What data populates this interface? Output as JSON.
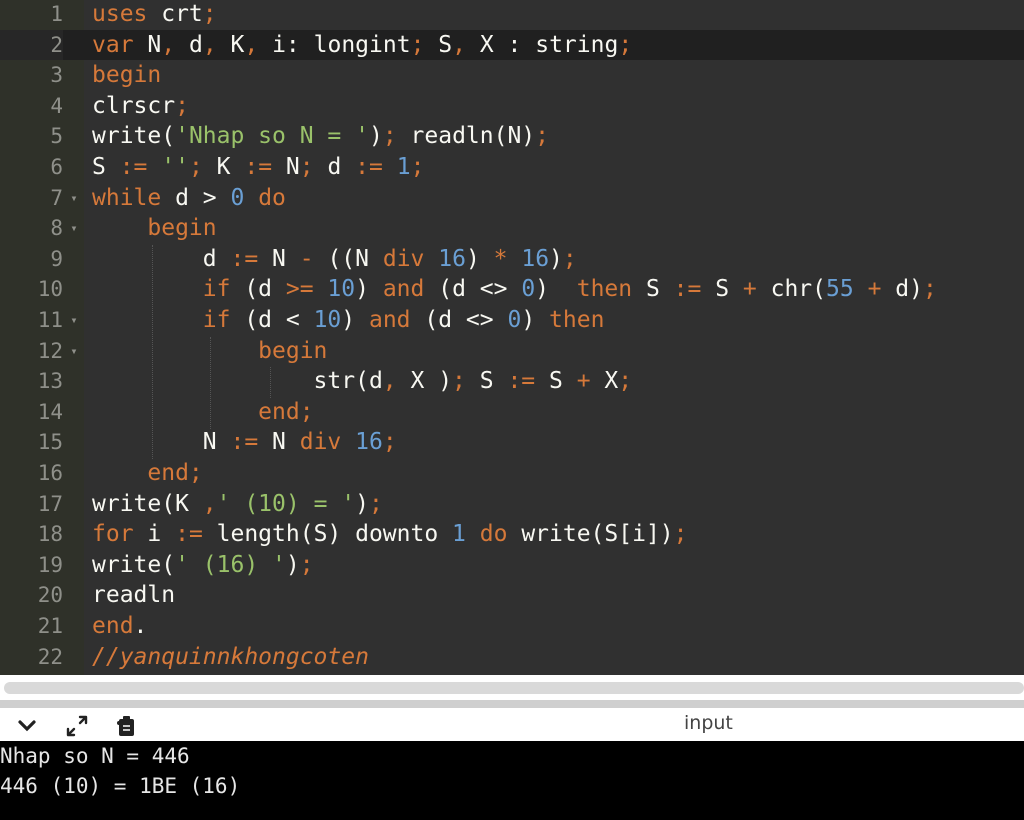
{
  "editor": {
    "lines": [
      {
        "n": "1",
        "tokens": [
          {
            "t": "uses",
            "c": "kw"
          },
          {
            "t": " crt",
            "c": "pl"
          },
          {
            "t": ";",
            "c": "op"
          }
        ]
      },
      {
        "n": "2",
        "active": true,
        "tokens": [
          {
            "t": "var",
            "c": "kw"
          },
          {
            "t": " N",
            "c": "pl"
          },
          {
            "t": ",",
            "c": "op"
          },
          {
            "t": " d",
            "c": "pl"
          },
          {
            "t": ",",
            "c": "op"
          },
          {
            "t": " K",
            "c": "pl"
          },
          {
            "t": ",",
            "c": "op"
          },
          {
            "t": " i: longint",
            "c": "pl"
          },
          {
            "t": ";",
            "c": "op"
          },
          {
            "t": " S",
            "c": "pl"
          },
          {
            "t": ",",
            "c": "op"
          },
          {
            "t": " X : string",
            "c": "pl"
          },
          {
            "t": ";",
            "c": "op"
          }
        ]
      },
      {
        "n": "3",
        "tokens": [
          {
            "t": "begin",
            "c": "kw"
          }
        ]
      },
      {
        "n": "4",
        "tokens": [
          {
            "t": "clrscr",
            "c": "pl"
          },
          {
            "t": ";",
            "c": "op"
          }
        ]
      },
      {
        "n": "5",
        "tokens": [
          {
            "t": "write(",
            "c": "pl"
          },
          {
            "t": "'Nhap so N = '",
            "c": "str"
          },
          {
            "t": ")",
            "c": "pl"
          },
          {
            "t": ";",
            "c": "op"
          },
          {
            "t": " readln(N)",
            "c": "pl"
          },
          {
            "t": ";",
            "c": "op"
          }
        ]
      },
      {
        "n": "6",
        "tokens": [
          {
            "t": "S ",
            "c": "pl"
          },
          {
            "t": ":=",
            "c": "op"
          },
          {
            "t": " ''",
            "c": "str"
          },
          {
            "t": ";",
            "c": "op"
          },
          {
            "t": " K ",
            "c": "pl"
          },
          {
            "t": ":=",
            "c": "op"
          },
          {
            "t": " N",
            "c": "pl"
          },
          {
            "t": ";",
            "c": "op"
          },
          {
            "t": " d ",
            "c": "pl"
          },
          {
            "t": ":=",
            "c": "op"
          },
          {
            "t": " 1",
            "c": "num"
          },
          {
            "t": ";",
            "c": "op"
          }
        ]
      },
      {
        "n": "7",
        "fold": true,
        "tokens": [
          {
            "t": "while",
            "c": "kw"
          },
          {
            "t": " d > ",
            "c": "pl"
          },
          {
            "t": "0",
            "c": "num"
          },
          {
            "t": " do",
            "c": "kw"
          }
        ]
      },
      {
        "n": "8",
        "fold": true,
        "tokens": [
          {
            "t": "    begin",
            "c": "kw"
          }
        ]
      },
      {
        "n": "9",
        "tokens": [
          {
            "t": "        d ",
            "c": "pl"
          },
          {
            "t": ":=",
            "c": "op"
          },
          {
            "t": " N ",
            "c": "pl"
          },
          {
            "t": "-",
            "c": "op"
          },
          {
            "t": " ((N ",
            "c": "pl"
          },
          {
            "t": "div",
            "c": "kw"
          },
          {
            "t": " 16",
            "c": "num"
          },
          {
            "t": ") ",
            "c": "pl"
          },
          {
            "t": "*",
            "c": "op"
          },
          {
            "t": " 16",
            "c": "num"
          },
          {
            "t": ")",
            "c": "pl"
          },
          {
            "t": ";",
            "c": "op"
          }
        ]
      },
      {
        "n": "10",
        "tokens": [
          {
            "t": "        ",
            "c": "pl"
          },
          {
            "t": "if",
            "c": "kw"
          },
          {
            "t": " (d ",
            "c": "pl"
          },
          {
            "t": ">=",
            "c": "op"
          },
          {
            "t": " 10",
            "c": "num"
          },
          {
            "t": ") ",
            "c": "pl"
          },
          {
            "t": "and",
            "c": "kw"
          },
          {
            "t": " (d <> ",
            "c": "pl"
          },
          {
            "t": "0",
            "c": "num"
          },
          {
            "t": ")  ",
            "c": "pl"
          },
          {
            "t": "then",
            "c": "kw"
          },
          {
            "t": " S ",
            "c": "pl"
          },
          {
            "t": ":=",
            "c": "op"
          },
          {
            "t": " S ",
            "c": "pl"
          },
          {
            "t": "+",
            "c": "op"
          },
          {
            "t": " chr(",
            "c": "pl"
          },
          {
            "t": "55",
            "c": "num"
          },
          {
            "t": " ",
            "c": "pl"
          },
          {
            "t": "+",
            "c": "op"
          },
          {
            "t": " d)",
            "c": "pl"
          },
          {
            "t": ";",
            "c": "op"
          }
        ]
      },
      {
        "n": "11",
        "fold": true,
        "tokens": [
          {
            "t": "        ",
            "c": "pl"
          },
          {
            "t": "if",
            "c": "kw"
          },
          {
            "t": " (d < ",
            "c": "pl"
          },
          {
            "t": "10",
            "c": "num"
          },
          {
            "t": ") ",
            "c": "pl"
          },
          {
            "t": "and",
            "c": "kw"
          },
          {
            "t": " (d <> ",
            "c": "pl"
          },
          {
            "t": "0",
            "c": "num"
          },
          {
            "t": ") ",
            "c": "pl"
          },
          {
            "t": "then",
            "c": "kw"
          }
        ]
      },
      {
        "n": "12",
        "fold": true,
        "tokens": [
          {
            "t": "            begin",
            "c": "kw"
          }
        ]
      },
      {
        "n": "13",
        "tokens": [
          {
            "t": "                str(d",
            "c": "pl"
          },
          {
            "t": ",",
            "c": "op"
          },
          {
            "t": " X )",
            "c": "pl"
          },
          {
            "t": ";",
            "c": "op"
          },
          {
            "t": " S ",
            "c": "pl"
          },
          {
            "t": ":=",
            "c": "op"
          },
          {
            "t": " S ",
            "c": "pl"
          },
          {
            "t": "+",
            "c": "op"
          },
          {
            "t": " X",
            "c": "pl"
          },
          {
            "t": ";",
            "c": "op"
          }
        ]
      },
      {
        "n": "14",
        "tokens": [
          {
            "t": "            end;",
            "c": "kw"
          }
        ]
      },
      {
        "n": "15",
        "tokens": [
          {
            "t": "        N ",
            "c": "pl"
          },
          {
            "t": ":=",
            "c": "op"
          },
          {
            "t": " N ",
            "c": "pl"
          },
          {
            "t": "div",
            "c": "kw"
          },
          {
            "t": " 16",
            "c": "num"
          },
          {
            "t": ";",
            "c": "op"
          }
        ]
      },
      {
        "n": "16",
        "tokens": [
          {
            "t": "    end;",
            "c": "kw"
          }
        ]
      },
      {
        "n": "17",
        "tokens": [
          {
            "t": "write(K ",
            "c": "pl"
          },
          {
            "t": ",",
            "c": "op"
          },
          {
            "t": "' (10) = '",
            "c": "str"
          },
          {
            "t": ")",
            "c": "pl"
          },
          {
            "t": ";",
            "c": "op"
          }
        ]
      },
      {
        "n": "18",
        "tokens": [
          {
            "t": "for",
            "c": "kw"
          },
          {
            "t": " i ",
            "c": "pl"
          },
          {
            "t": ":=",
            "c": "op"
          },
          {
            "t": " length(S) downto ",
            "c": "pl"
          },
          {
            "t": "1",
            "c": "num"
          },
          {
            "t": " ",
            "c": "pl"
          },
          {
            "t": "do",
            "c": "kw"
          },
          {
            "t": " write(S[i])",
            "c": "pl"
          },
          {
            "t": ";",
            "c": "op"
          }
        ]
      },
      {
        "n": "19",
        "tokens": [
          {
            "t": "write(",
            "c": "pl"
          },
          {
            "t": "' (16) '",
            "c": "str"
          },
          {
            "t": ")",
            "c": "pl"
          },
          {
            "t": ";",
            "c": "op"
          }
        ]
      },
      {
        "n": "20",
        "tokens": [
          {
            "t": "readln",
            "c": "pl"
          }
        ]
      },
      {
        "n": "21",
        "tokens": [
          {
            "t": "end",
            "c": "kw"
          },
          {
            "t": ".",
            "c": "pl"
          }
        ]
      },
      {
        "n": "22",
        "tokens": [
          {
            "t": "//yanquinnkhongcoten",
            "c": "cmt"
          }
        ]
      }
    ]
  },
  "toolbar": {
    "icons": [
      "chevron-down-icon",
      "expand-icon",
      "clipboard-icon"
    ],
    "title": "input"
  },
  "console": {
    "lines": [
      "Nhap so N = 446",
      "446 (10) = 1BE (16)"
    ]
  },
  "colors": {
    "keyword": "#d6793a",
    "number": "#6a9fd4",
    "string": "#9ac26a",
    "plain": "#f8f8f2",
    "background": "#303030"
  }
}
